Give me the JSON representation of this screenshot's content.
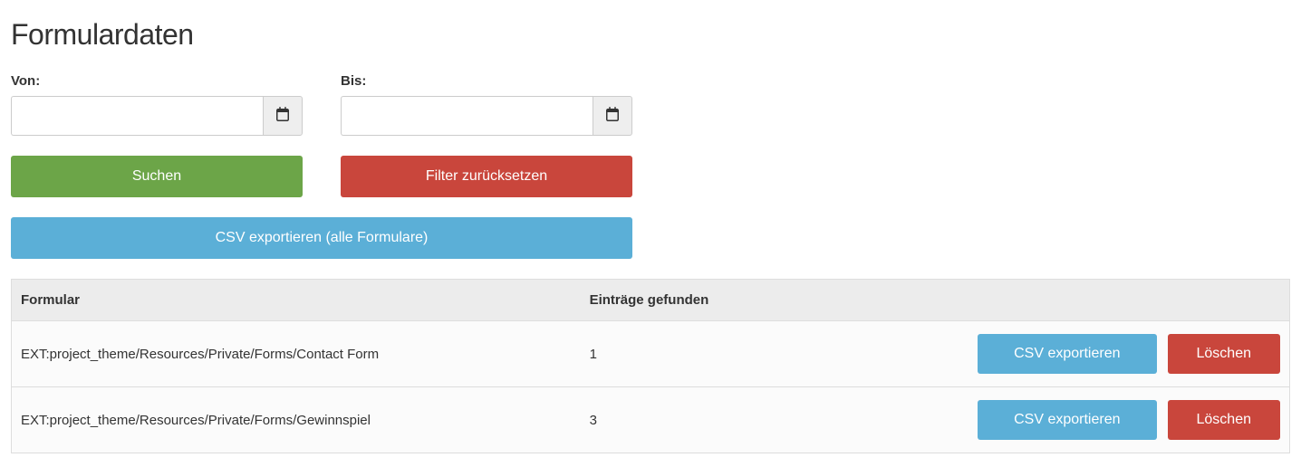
{
  "title": "Formulardaten",
  "filters": {
    "from_label": "Von:",
    "from_value": "",
    "to_label": "Bis:",
    "to_value": ""
  },
  "buttons": {
    "search": "Suchen",
    "reset": "Filter zurücksetzen",
    "export_all": "CSV exportieren (alle Formulare)",
    "export_row": "CSV exportieren",
    "delete_row": "Löschen"
  },
  "table": {
    "headers": {
      "form": "Formular",
      "entries": "Einträge gefunden"
    },
    "rows": [
      {
        "form": "EXT:project_theme/Resources/Private/Forms/Contact Form",
        "entries": "1"
      },
      {
        "form": "EXT:project_theme/Resources/Private/Forms/Gewinnspiel",
        "entries": "3"
      }
    ]
  }
}
